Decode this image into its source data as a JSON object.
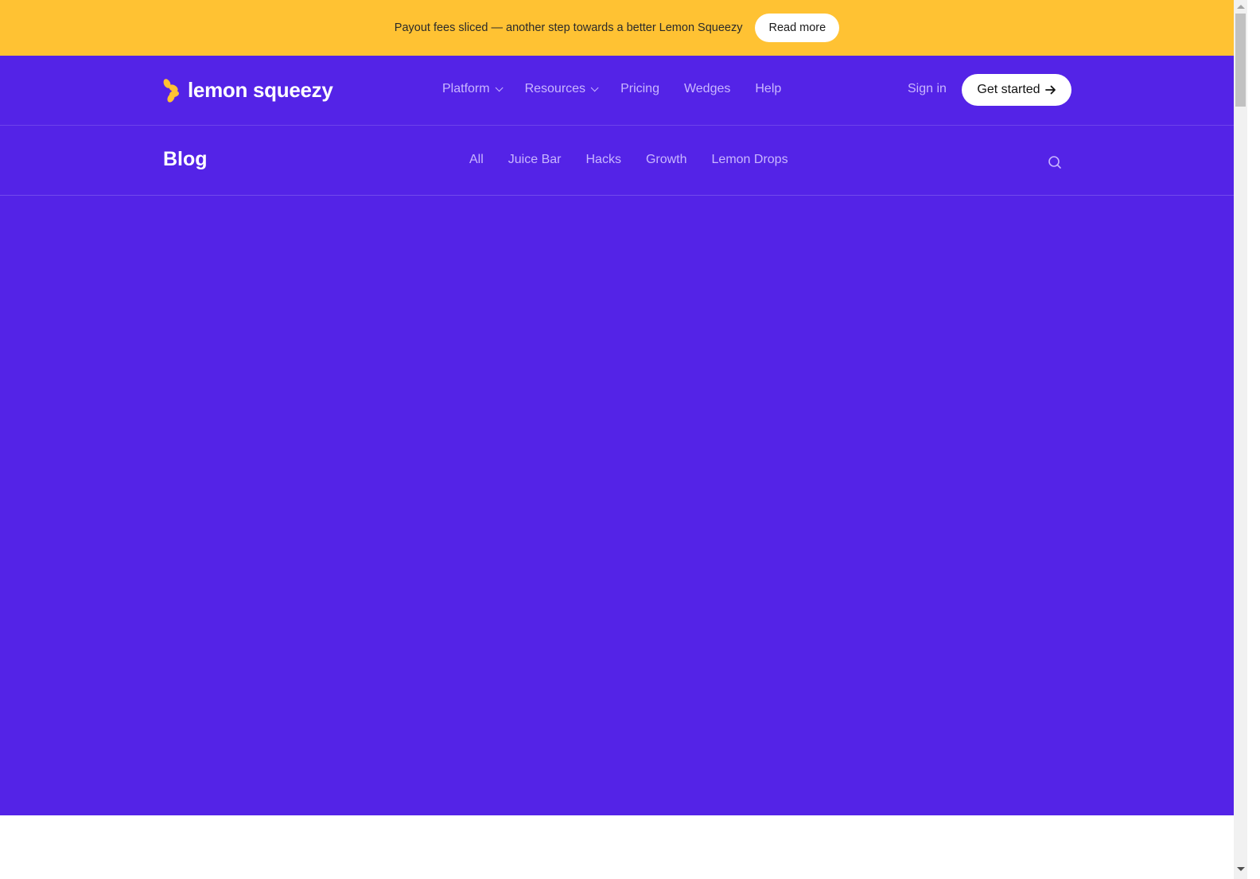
{
  "banner": {
    "text": "Payout fees sliced — another step towards a better Lemon Squeezy",
    "button_label": "Read more"
  },
  "header": {
    "logo_text": "lemon squeezy",
    "nav": [
      {
        "label": "Platform",
        "has_dropdown": true
      },
      {
        "label": "Resources",
        "has_dropdown": true
      },
      {
        "label": "Pricing",
        "has_dropdown": false
      },
      {
        "label": "Wedges",
        "has_dropdown": false
      },
      {
        "label": "Help",
        "has_dropdown": false
      }
    ],
    "sign_in_label": "Sign in",
    "get_started_label": "Get started",
    "get_started_icon": "arrow-right-icon"
  },
  "blog_nav": {
    "title": "Blog",
    "categories": [
      "All",
      "Juice Bar",
      "Hacks",
      "Growth",
      "Lemon Drops"
    ],
    "search_icon": "search-icon"
  },
  "colors": {
    "banner_bg": "#FFC233",
    "brand_purple": "#5423E7",
    "nav_text": "#C9B6FF",
    "logo_accent": "#FFC233"
  }
}
